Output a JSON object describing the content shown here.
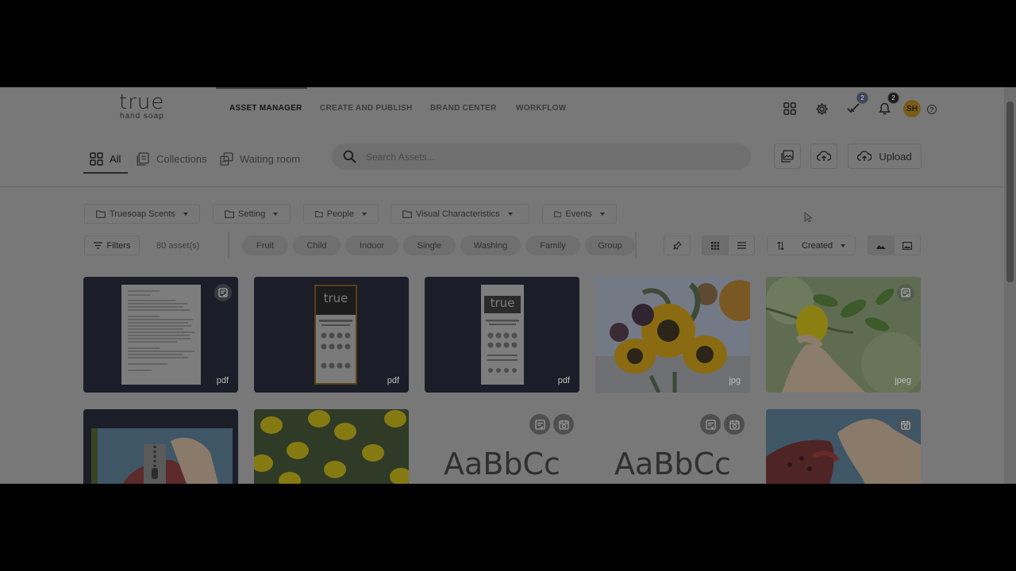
{
  "logo": {
    "word": "true",
    "tagline": "hand soap"
  },
  "nav": {
    "links": [
      "ASSET MANAGER",
      "CREATE AND PUBLISH",
      "BRAND CENTER",
      "WORKFLOW"
    ],
    "active": "ASSET MANAGER"
  },
  "top_icons": {
    "tasks_badge": "2",
    "notifications_badge": "2",
    "avatar_initials": "SH",
    "help": "?"
  },
  "subtabs": [
    {
      "label": "All",
      "icon": "grid-icon"
    },
    {
      "label": "Collections",
      "icon": "collections-icon"
    },
    {
      "label": "Waiting room",
      "icon": "waiting-room-icon"
    }
  ],
  "search": {
    "placeholder": "Search Assets..."
  },
  "upload": {
    "label": "Upload"
  },
  "folders": [
    "Truesoap Scents",
    "Setting",
    "People",
    "Visual Characteristics",
    "Events"
  ],
  "toolbar": {
    "filters_label": "Filters",
    "asset_count": "80 asset(s)",
    "sort_label": "Created"
  },
  "chips": [
    "Fruit",
    "Child",
    "Indoor",
    "Single",
    "Washing",
    "Family",
    "Group"
  ],
  "assets": [
    {
      "type": "document",
      "ext": "pdf"
    },
    {
      "type": "brochure",
      "ext": "pdf",
      "logo_text": "true"
    },
    {
      "type": "flyer",
      "ext": "pdf",
      "logo_text": "true"
    },
    {
      "type": "photo",
      "subject": "sunflowers",
      "ext": "jpg"
    },
    {
      "type": "photo",
      "subject": "lemon in hand",
      "ext": "jpeg"
    },
    {
      "type": "archive",
      "subject": "pomegranate"
    },
    {
      "type": "photo",
      "subject": "lemons on green"
    },
    {
      "type": "font",
      "sample": "AaBbCc"
    },
    {
      "type": "font",
      "sample": "AaBbCc"
    },
    {
      "type": "photo",
      "subject": "pomegranate"
    }
  ],
  "colors": {
    "overlay_bg": "#787878",
    "dark_card": "#1b1e28",
    "avatar": "#7a5a17"
  }
}
